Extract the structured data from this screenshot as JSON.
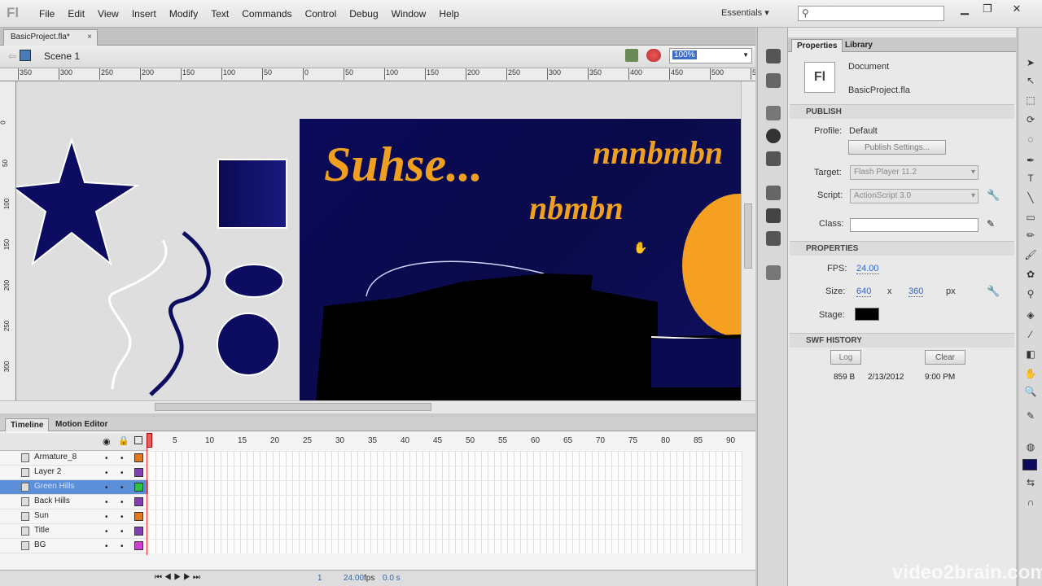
{
  "app": {
    "logo": "Fl",
    "workspace": "Essentials",
    "search_placeholder": "",
    "min": "▭",
    "restore": "❐",
    "close": "✕"
  },
  "menu": [
    "File",
    "Edit",
    "View",
    "Insert",
    "Modify",
    "Text",
    "Commands",
    "Control",
    "Debug",
    "Window",
    "Help"
  ],
  "document": {
    "tab": "BasicProject.fla*",
    "tab_close": "×",
    "scene": "Scene 1",
    "zoom": "100%"
  },
  "ruler": {
    "h_ticks": [
      "350",
      "300",
      "250",
      "200",
      "150",
      "100",
      "50",
      "0",
      "50",
      "100",
      "150",
      "200",
      "250",
      "300",
      "350",
      "400",
      "450",
      "500",
      "550"
    ],
    "v_ticks": [
      "0",
      "50",
      "100",
      "150",
      "200",
      "250",
      "300"
    ]
  },
  "stage_text": {
    "title": "Suhse...",
    "line1": "nnnbmbn",
    "line2": "nbmbn"
  },
  "timeline": {
    "tabs": [
      "Timeline",
      "Motion Editor"
    ],
    "frame_numbers": [
      "5",
      "10",
      "15",
      "20",
      "25",
      "30",
      "35",
      "40",
      "45",
      "50",
      "55",
      "60",
      "65",
      "70",
      "75",
      "80",
      "85",
      "90"
    ],
    "layers": [
      {
        "name": "Armature_8",
        "color": "#e07820"
      },
      {
        "name": "Layer 2",
        "color": "#8040b0"
      },
      {
        "name": "Green Hills",
        "color": "#30c040",
        "selected": true
      },
      {
        "name": "Back Hills",
        "color": "#8040b0"
      },
      {
        "name": "Sun",
        "color": "#e07820"
      },
      {
        "name": "Title",
        "color": "#8040b0"
      },
      {
        "name": "BG",
        "color": "#d040d0"
      }
    ],
    "current_frame": "1",
    "fps": "24.00",
    "fps_unit": "fps",
    "time": "0.0 s"
  },
  "properties": {
    "tabs": [
      "Properties",
      "Library"
    ],
    "doc_icon": "Fl",
    "doc_type": "Document",
    "doc_name": "BasicProject.fla",
    "publish_header": "PUBLISH",
    "profile_label": "Profile:",
    "profile_value": "Default",
    "publish_settings": "Publish Settings...",
    "target_label": "Target:",
    "target_value": "Flash Player 11.2",
    "script_label": "Script:",
    "script_value": "ActionScript 3.0",
    "class_label": "Class:",
    "properties_header": "PROPERTIES",
    "fps_label": "FPS:",
    "fps_value": "24.00",
    "size_label": "Size:",
    "width": "640",
    "x": "x",
    "height": "360",
    "px": "px",
    "stage_label": "Stage:",
    "stage_color": "#000000",
    "swf_header": "SWF HISTORY",
    "log": "Log",
    "clear": "Clear",
    "history": {
      "size": "859 B",
      "date": "2/13/2012",
      "time": "9:00 PM"
    }
  },
  "watermark": "video2brain.com",
  "colors": {
    "stage_bg": "#0a0a5a",
    "title_orange": "#f0a020",
    "shape_fill": "#0c0c60",
    "sun": "#f5a020"
  }
}
